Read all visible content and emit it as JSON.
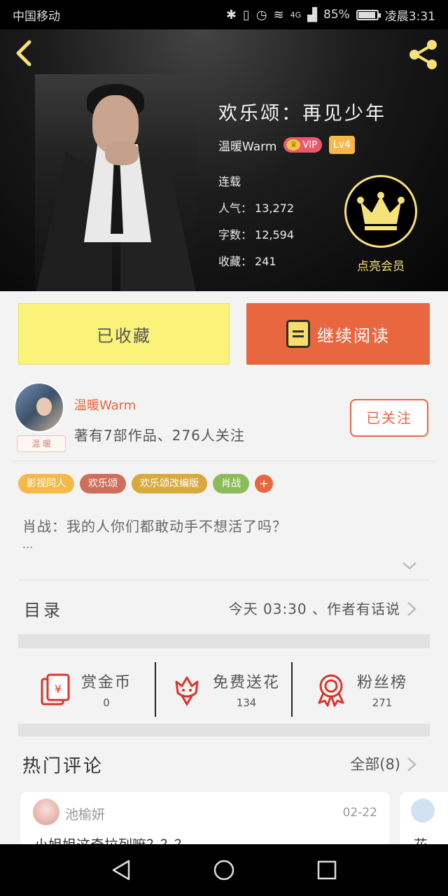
{
  "status_bar": {
    "carrier": "中国移动",
    "network": "4G",
    "battery": "85%",
    "battery_level": 0.85,
    "time": "凌晨3:31"
  },
  "book": {
    "title": "欢乐颂：再见少年",
    "author": "温暖Warm",
    "vip_label": "VIP",
    "level": "Lv4",
    "status": "连载",
    "popularity_label": "人气：",
    "popularity": "13,272",
    "words_label": "字数：",
    "words": "12,594",
    "favorites_label": "收藏：",
    "favorites": "241",
    "vip_cta": "点亮会员"
  },
  "actions": {
    "collected": "已收藏",
    "continue_reading": "继续阅读"
  },
  "author": {
    "name": "温暖Warm",
    "tag": "温 暖",
    "meta": "著有7部作品、276人关注",
    "follow": "已关注"
  },
  "tags": [
    {
      "label": "影视同人",
      "color": "#f5b94a"
    },
    {
      "label": "欢乐颂",
      "color": "#cf6e5b"
    },
    {
      "label": "欢乐颂改编版",
      "color": "#d9a93c"
    },
    {
      "label": "肖战",
      "color": "#8dbb5a"
    }
  ],
  "tag_more": "+",
  "synopsis": "肖战：我的人你们都敢动手不想活了吗？",
  "synopsis_more": "...",
  "toc": {
    "label": "目录",
    "update": "今天 03:30 、作者有话说"
  },
  "stats": {
    "coin_label": "赏金币",
    "coin_value": "0",
    "flower_label": "免费送花",
    "flower_value": "134",
    "fans_label": "粉丝榜",
    "fans_value": "271"
  },
  "comments": {
    "title": "热门评论",
    "all": "全部(8)",
    "items": [
      {
        "user": "池榆妍",
        "date": "02-22",
        "text": "小姐姐这奇拉列嘛？？？"
      },
      {
        "user": "",
        "date": "",
        "text": "花"
      }
    ]
  },
  "colors": {
    "accent": "#e8673f",
    "collected_bg": "#fbf27a",
    "vip_gold": "#f7e27a"
  }
}
